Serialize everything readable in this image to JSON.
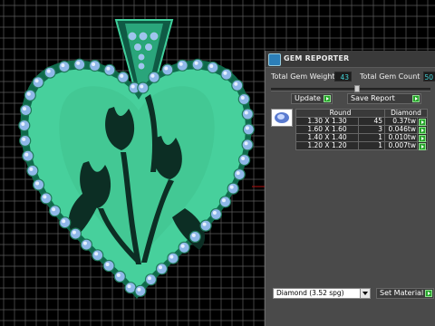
{
  "panel": {
    "title": "GEM REPORTER",
    "total_gem_weight_label": "Total Gem Weight",
    "total_gem_weight_value": "43",
    "total_gem_count_label": "Total Gem Count",
    "total_gem_count_value": "50",
    "slider_value": 0.54,
    "update_label": "Update",
    "save_report_label": "Save Report",
    "table": {
      "headers": [
        "Round",
        "Diamond"
      ],
      "rows": [
        {
          "size": "1.30 X 1.30",
          "count": "45",
          "weight": "0.37tw"
        },
        {
          "size": "1.60 X 1.60",
          "count": "3",
          "weight": "0.046tw"
        },
        {
          "size": "1.40 X 1.40",
          "count": "1",
          "weight": "0.010tw"
        },
        {
          "size": "1.20 X 1.20",
          "count": "1",
          "weight": "0.007tw"
        }
      ]
    },
    "material_value": "Diamond   (3.52 spg)",
    "set_material_label": "Set Material"
  },
  "colors": {
    "background": "#000000",
    "grid": "#5a5a5a",
    "pendant": "#3fcf9b",
    "pendant_dark": "#0f5a44",
    "gem": "#8fb8e8",
    "panel": "#4a4a4a",
    "value_text": "#44d4d8",
    "accent_green": "#27a62b"
  },
  "icons": {
    "app_icon": "gem-reporter-app-icon",
    "gem_preview": "round-gem-icon",
    "go_button": "green-arrow-icon",
    "dropdown": "chevron-down-icon"
  }
}
